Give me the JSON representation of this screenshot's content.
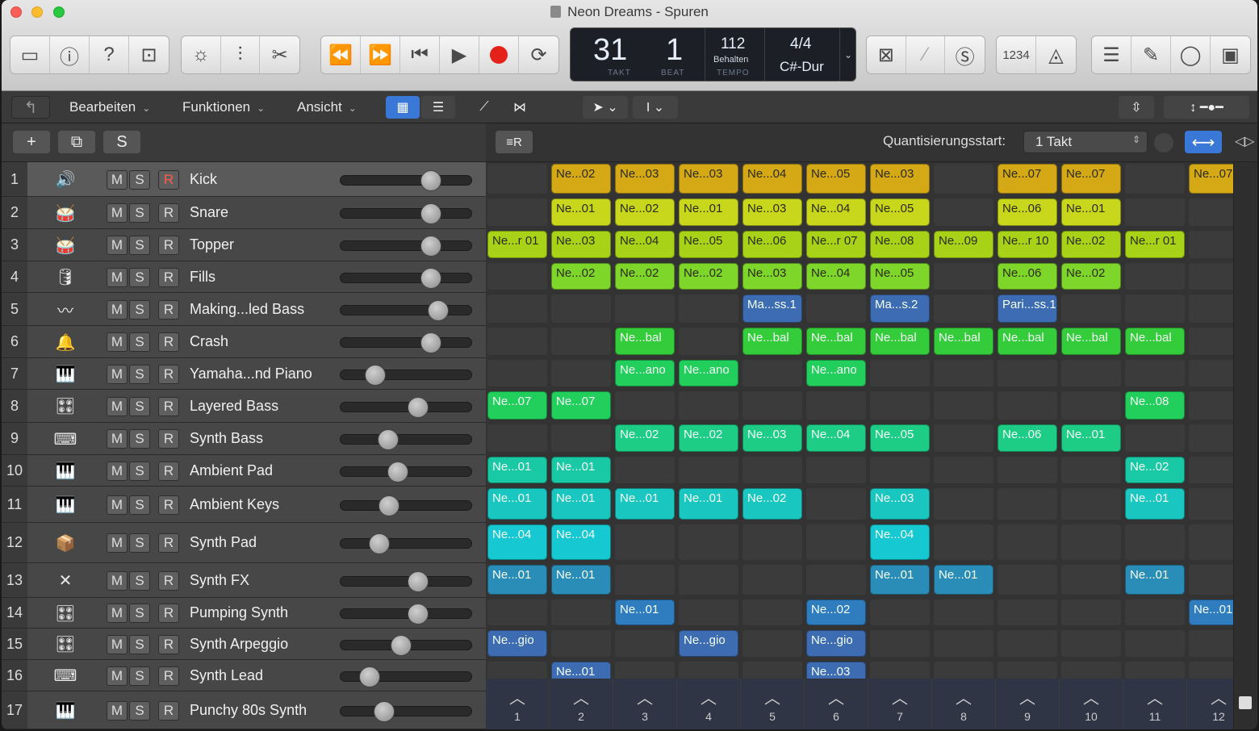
{
  "window": {
    "title": "Neon Dreams - Spuren"
  },
  "toolbar": {
    "group1": [
      "inbox-icon",
      "info-icon",
      "help-icon",
      "library-icon"
    ],
    "group2": [
      "smart-controls-icon",
      "mixer-icon",
      "scissors-icon"
    ],
    "transport": [
      "rewind-icon",
      "forward-icon",
      "to-start-icon",
      "play-icon",
      "record-icon",
      "cycle-icon"
    ],
    "right1": [
      "replace-icon",
      "tuner-icon",
      "solo-icon"
    ],
    "count_in": "1234",
    "right2": [
      "list-icon",
      "note-pad-icon",
      "loop-browser-icon",
      "browser-icon"
    ]
  },
  "lcd": {
    "bar": "31",
    "beat": "1",
    "bar_label": "TAKT",
    "beat_label": "BEAT",
    "tempo": "112",
    "tempo_mode": "Behalten",
    "tempo_label": "TEMPO",
    "signature": "4/4",
    "key": "C#-Dur"
  },
  "menubar": {
    "back": "↰",
    "edit": "Bearbeiten",
    "functions": "Funktionen",
    "view": "Ansicht"
  },
  "track_header": {
    "add": "+",
    "duplicate": "⧉",
    "solo": "S"
  },
  "region_header": {
    "quant_label": "Quantisierungsstart:",
    "quant_value": "1 Takt"
  },
  "tracks": [
    {
      "num": "1",
      "name": "Kick",
      "icon": "🔊",
      "fader": 0.72,
      "rec_armed": true
    },
    {
      "num": "2",
      "name": "Snare",
      "icon": "🥁",
      "fader": 0.72,
      "rec_armed": false
    },
    {
      "num": "3",
      "name": "Topper",
      "icon": "🥁",
      "fader": 0.72,
      "rec_armed": false
    },
    {
      "num": "4",
      "name": "Fills",
      "icon": "🛢",
      "fader": 0.72,
      "rec_armed": false
    },
    {
      "num": "5",
      "name": "Making...led Bass",
      "icon": "〰",
      "fader": 0.78,
      "rec_armed": false
    },
    {
      "num": "6",
      "name": "Crash",
      "icon": "🔔",
      "fader": 0.72,
      "rec_armed": false
    },
    {
      "num": "7",
      "name": "Yamaha...nd Piano",
      "icon": "🎹",
      "fader": 0.22,
      "rec_armed": false
    },
    {
      "num": "8",
      "name": "Layered Bass",
      "icon": "🎛",
      "fader": 0.6,
      "rec_armed": false
    },
    {
      "num": "9",
      "name": "Synth Bass",
      "icon": "⌨",
      "fader": 0.33,
      "rec_armed": false
    },
    {
      "num": "10",
      "name": "Ambient Pad",
      "icon": "🎹",
      "fader": 0.42,
      "rec_armed": false
    },
    {
      "num": "11",
      "name": "Ambient Keys",
      "icon": "🎹",
      "fader": 0.34,
      "rec_armed": false
    },
    {
      "num": "12",
      "name": "Synth Pad",
      "icon": "📦",
      "fader": 0.25,
      "rec_armed": false
    },
    {
      "num": "13",
      "name": "Synth FX",
      "icon": "✕",
      "fader": 0.6,
      "rec_armed": false
    },
    {
      "num": "14",
      "name": "Pumping Synth",
      "icon": "🎛",
      "fader": 0.6,
      "rec_armed": false
    },
    {
      "num": "15",
      "name": "Synth Arpeggio",
      "icon": "🎛",
      "fader": 0.45,
      "rec_armed": false
    },
    {
      "num": "16",
      "name": "Synth Lead",
      "icon": "⌨",
      "fader": 0.17,
      "rec_armed": false
    },
    {
      "num": "17",
      "name": "Punchy 80s Synth",
      "icon": "🎹",
      "fader": 0.3,
      "rec_armed": false
    }
  ],
  "msr": {
    "m": "M",
    "s": "S",
    "r": "R"
  },
  "colors": {
    "yellow": "#d8ab18",
    "lime": "#b3d11e",
    "green": "#2fd04a",
    "teal": "#1cc8a0",
    "cyan": "#16c6cc",
    "blue": "#2c86b8",
    "navy": "#3a66a8"
  },
  "regions": [
    {
      "row": 0,
      "col": 1,
      "label": "Ne...02",
      "color": "yellow"
    },
    {
      "row": 0,
      "col": 2,
      "label": "Ne...03",
      "color": "yellow"
    },
    {
      "row": 0,
      "col": 3,
      "label": "Ne...03",
      "color": "yellow"
    },
    {
      "row": 0,
      "col": 4,
      "label": "Ne...04",
      "color": "yellow"
    },
    {
      "row": 0,
      "col": 5,
      "label": "Ne...05",
      "color": "yellow"
    },
    {
      "row": 0,
      "col": 6,
      "label": "Ne...03",
      "color": "yellow"
    },
    {
      "row": 0,
      "col": 8,
      "label": "Ne...07",
      "color": "yellow"
    },
    {
      "row": 0,
      "col": 9,
      "label": "Ne...07",
      "color": "yellow"
    },
    {
      "row": 0,
      "col": 11,
      "label": "Ne...07",
      "color": "yellow"
    },
    {
      "row": 1,
      "col": 1,
      "label": "Ne...01",
      "color": "lime2"
    },
    {
      "row": 1,
      "col": 2,
      "label": "Ne...02",
      "color": "lime2"
    },
    {
      "row": 1,
      "col": 3,
      "label": "Ne...01",
      "color": "lime2"
    },
    {
      "row": 1,
      "col": 4,
      "label": "Ne...03",
      "color": "lime2"
    },
    {
      "row": 1,
      "col": 5,
      "label": "Ne...04",
      "color": "lime2"
    },
    {
      "row": 1,
      "col": 6,
      "label": "Ne...05",
      "color": "lime2"
    },
    {
      "row": 1,
      "col": 8,
      "label": "Ne...06",
      "color": "lime2"
    },
    {
      "row": 1,
      "col": 9,
      "label": "Ne...01",
      "color": "lime2"
    },
    {
      "row": 2,
      "col": 0,
      "label": "Ne...r 01",
      "color": "lime"
    },
    {
      "row": 2,
      "col": 1,
      "label": "Ne...03",
      "color": "lime"
    },
    {
      "row": 2,
      "col": 2,
      "label": "Ne...04",
      "color": "lime"
    },
    {
      "row": 2,
      "col": 3,
      "label": "Ne...05",
      "color": "lime"
    },
    {
      "row": 2,
      "col": 4,
      "label": "Ne...06",
      "color": "lime"
    },
    {
      "row": 2,
      "col": 5,
      "label": "Ne...r 07",
      "color": "lime"
    },
    {
      "row": 2,
      "col": 6,
      "label": "Ne...08",
      "color": "lime"
    },
    {
      "row": 2,
      "col": 7,
      "label": "Ne...09",
      "color": "lime"
    },
    {
      "row": 2,
      "col": 8,
      "label": "Ne...r 10",
      "color": "lime"
    },
    {
      "row": 2,
      "col": 9,
      "label": "Ne...02",
      "color": "lime"
    },
    {
      "row": 2,
      "col": 10,
      "label": "Ne...r 01",
      "color": "lime"
    },
    {
      "row": 3,
      "col": 1,
      "label": "Ne...02",
      "color": "lgreen"
    },
    {
      "row": 3,
      "col": 2,
      "label": "Ne...02",
      "color": "lgreen"
    },
    {
      "row": 3,
      "col": 3,
      "label": "Ne...02",
      "color": "lgreen"
    },
    {
      "row": 3,
      "col": 4,
      "label": "Ne...03",
      "color": "lgreen"
    },
    {
      "row": 3,
      "col": 5,
      "label": "Ne...04",
      "color": "lgreen"
    },
    {
      "row": 3,
      "col": 6,
      "label": "Ne...05",
      "color": "lgreen"
    },
    {
      "row": 3,
      "col": 8,
      "label": "Ne...06",
      "color": "lgreen"
    },
    {
      "row": 3,
      "col": 9,
      "label": "Ne...02",
      "color": "lgreen"
    },
    {
      "row": 4,
      "col": 4,
      "label": "Ma...ss.1",
      "color": "navy"
    },
    {
      "row": 4,
      "col": 6,
      "label": "Ma...s.2",
      "color": "navy"
    },
    {
      "row": 4,
      "col": 8,
      "label": "Pari...ss.1",
      "color": "navy"
    },
    {
      "row": 5,
      "col": 2,
      "label": "Ne...bal",
      "color": "green"
    },
    {
      "row": 5,
      "col": 4,
      "label": "Ne...bal",
      "color": "green"
    },
    {
      "row": 5,
      "col": 5,
      "label": "Ne...bal",
      "color": "green"
    },
    {
      "row": 5,
      "col": 6,
      "label": "Ne...bal",
      "color": "green"
    },
    {
      "row": 5,
      "col": 7,
      "label": "Ne...bal",
      "color": "green"
    },
    {
      "row": 5,
      "col": 8,
      "label": "Ne...bal",
      "color": "green"
    },
    {
      "row": 5,
      "col": 9,
      "label": "Ne...bal",
      "color": "green"
    },
    {
      "row": 5,
      "col": 10,
      "label": "Ne...bal",
      "color": "green"
    },
    {
      "row": 6,
      "col": 2,
      "label": "Ne...ano",
      "color": "green2"
    },
    {
      "row": 6,
      "col": 3,
      "label": "Ne...ano",
      "color": "green2"
    },
    {
      "row": 6,
      "col": 5,
      "label": "Ne...ano",
      "color": "green2"
    },
    {
      "row": 7,
      "col": 0,
      "label": "Ne...07",
      "color": "green2"
    },
    {
      "row": 7,
      "col": 1,
      "label": "Ne...07",
      "color": "green2"
    },
    {
      "row": 7,
      "col": 10,
      "label": "Ne...08",
      "color": "green2"
    },
    {
      "row": 8,
      "col": 2,
      "label": "Ne...02",
      "color": "green3"
    },
    {
      "row": 8,
      "col": 3,
      "label": "Ne...02",
      "color": "green3"
    },
    {
      "row": 8,
      "col": 4,
      "label": "Ne...03",
      "color": "green3"
    },
    {
      "row": 8,
      "col": 5,
      "label": "Ne...04",
      "color": "green3"
    },
    {
      "row": 8,
      "col": 6,
      "label": "Ne...05",
      "color": "green3"
    },
    {
      "row": 8,
      "col": 8,
      "label": "Ne...06",
      "color": "green3"
    },
    {
      "row": 8,
      "col": 9,
      "label": "Ne...01",
      "color": "green3"
    },
    {
      "row": 9,
      "col": 0,
      "label": "Ne...01",
      "color": "teal"
    },
    {
      "row": 9,
      "col": 1,
      "label": "Ne...01",
      "color": "teal"
    },
    {
      "row": 9,
      "col": 10,
      "label": "Ne...02",
      "color": "teal"
    },
    {
      "row": 10,
      "col": 0,
      "label": "Ne...01",
      "color": "teal2"
    },
    {
      "row": 10,
      "col": 1,
      "label": "Ne...01",
      "color": "teal2"
    },
    {
      "row": 10,
      "col": 2,
      "label": "Ne...01",
      "color": "teal2"
    },
    {
      "row": 10,
      "col": 3,
      "label": "Ne...01",
      "color": "teal2"
    },
    {
      "row": 10,
      "col": 4,
      "label": "Ne...02",
      "color": "teal2"
    },
    {
      "row": 10,
      "col": 6,
      "label": "Ne...03",
      "color": "teal2"
    },
    {
      "row": 10,
      "col": 10,
      "label": "Ne...01",
      "color": "teal2"
    },
    {
      "row": 11,
      "col": 0,
      "label": "Ne...04",
      "color": "cyan"
    },
    {
      "row": 11,
      "col": 1,
      "label": "Ne...04",
      "color": "cyan"
    },
    {
      "row": 11,
      "col": 6,
      "label": "Ne...04",
      "color": "cyan"
    },
    {
      "row": 12,
      "col": 0,
      "label": "Ne...01",
      "color": "blue"
    },
    {
      "row": 12,
      "col": 1,
      "label": "Ne...01",
      "color": "blue"
    },
    {
      "row": 12,
      "col": 6,
      "label": "Ne...01",
      "color": "blue"
    },
    {
      "row": 12,
      "col": 7,
      "label": "Ne...01",
      "color": "blue"
    },
    {
      "row": 12,
      "col": 10,
      "label": "Ne...01",
      "color": "blue"
    },
    {
      "row": 13,
      "col": 2,
      "label": "Ne...01",
      "color": "blue2"
    },
    {
      "row": 13,
      "col": 5,
      "label": "Ne...02",
      "color": "blue2"
    },
    {
      "row": 13,
      "col": 11,
      "label": "Ne...01",
      "color": "blue2"
    },
    {
      "row": 14,
      "col": 0,
      "label": "Ne...gio",
      "color": "navy"
    },
    {
      "row": 14,
      "col": 3,
      "label": "Ne...gio",
      "color": "navy"
    },
    {
      "row": 14,
      "col": 5,
      "label": "Ne...gio",
      "color": "navy"
    },
    {
      "row": 15,
      "col": 1,
      "label": "Ne...01",
      "color": "navy"
    },
    {
      "row": 15,
      "col": 5,
      "label": "Ne...03",
      "color": "navy"
    }
  ],
  "triggers": [
    "1",
    "2",
    "3",
    "4",
    "5",
    "6",
    "7",
    "8",
    "9",
    "10",
    "11",
    "12"
  ]
}
